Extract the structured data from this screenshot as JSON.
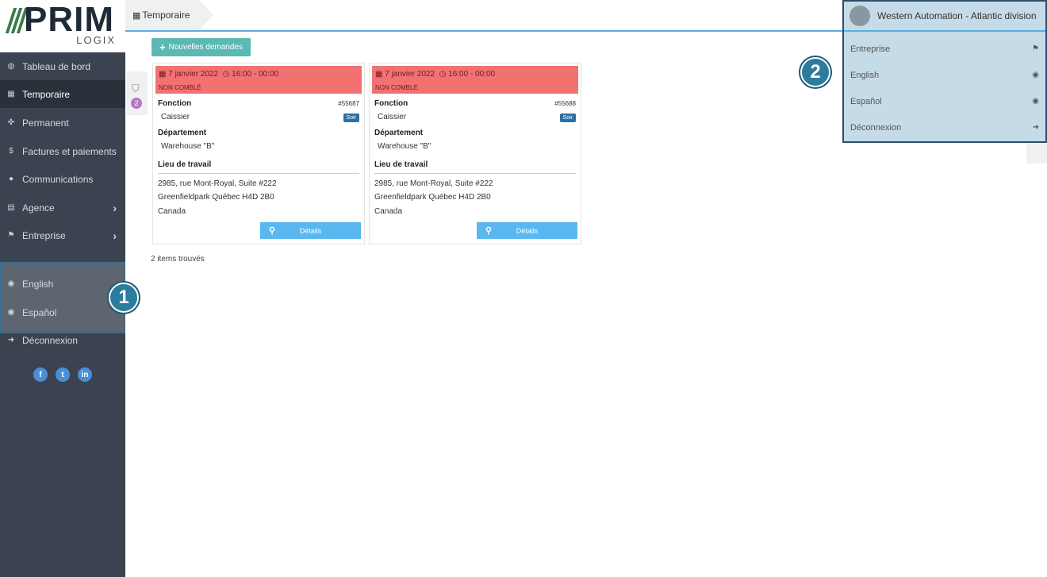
{
  "logo": {
    "word": "PRIM",
    "sub": "LOGIX"
  },
  "sidebar": {
    "items": [
      {
        "label": "Tableau de bord",
        "icon": "dashboard-icon",
        "glyph": "◍"
      },
      {
        "label": "Temporaire",
        "icon": "calendar-icon",
        "glyph": "▦"
      },
      {
        "label": "Permanent",
        "icon": "pin-icon",
        "glyph": "✜"
      },
      {
        "label": "Factures et paiements",
        "icon": "dollar-icon",
        "glyph": "$"
      },
      {
        "label": "Communications",
        "icon": "chat-icon",
        "glyph": "●"
      },
      {
        "label": "Agence",
        "icon": "building-icon",
        "glyph": "▤",
        "chevron": "›"
      },
      {
        "label": "Entreprise",
        "icon": "flag-icon",
        "glyph": "⚑",
        "chevron": "›"
      }
    ],
    "lang": [
      {
        "label": "English",
        "icon": "globe-icon",
        "glyph": "◉"
      },
      {
        "label": "Español",
        "icon": "globe-icon",
        "glyph": "◉"
      }
    ],
    "logout": {
      "label": "Déconnexion",
      "glyph": "➜"
    },
    "social": [
      "f",
      "t",
      "in"
    ],
    "badge": "1"
  },
  "topbar": {
    "crumb_icon": "▦",
    "crumb": "Temporaire"
  },
  "filter": {
    "count": "2"
  },
  "new_button": {
    "plus": "+",
    "label": "Nouvelles demandes"
  },
  "cards": [
    {
      "date": "7 janvier 2022",
      "time": "16:00 - 00:00",
      "status": "NON COMBLÉ",
      "fonction_label": "Fonction",
      "fonction": "Caissier",
      "number": "#55687",
      "tag": "Soir",
      "dept_label": "Département",
      "dept": "Warehouse \"B\"",
      "lieu_label": "Lieu de travail",
      "addr1": "2985, rue Mont-Royal, Suite #222",
      "addr2": "Greenfieldpark Québec H4D 2B0",
      "addr3": "Canada",
      "details": "Détails"
    },
    {
      "date": "7 janvier 2022",
      "time": "16:00 - 00:00",
      "status": "NON COMBLÉ",
      "fonction_label": "Fonction",
      "fonction": "Caissier",
      "number": "#55688",
      "tag": "Soir",
      "dept_label": "Département",
      "dept": "Warehouse \"B\"",
      "lieu_label": "Lieu de travail",
      "addr1": "2985, rue Mont-Royal, Suite #222",
      "addr2": "Greenfieldpark Québec H4D 2B0",
      "addr3": "Canada",
      "details": "Détails"
    }
  ],
  "found": "2 items trouvés",
  "dropdown": {
    "user": "Western Automation - Atlantic division",
    "items": [
      {
        "label": "Entreprise",
        "glyph": "⚑"
      },
      {
        "label": "English",
        "glyph": "◉"
      },
      {
        "label": "Español",
        "glyph": "◉"
      },
      {
        "label": "Déconnexion",
        "glyph": "➜"
      }
    ],
    "badge": "2"
  }
}
